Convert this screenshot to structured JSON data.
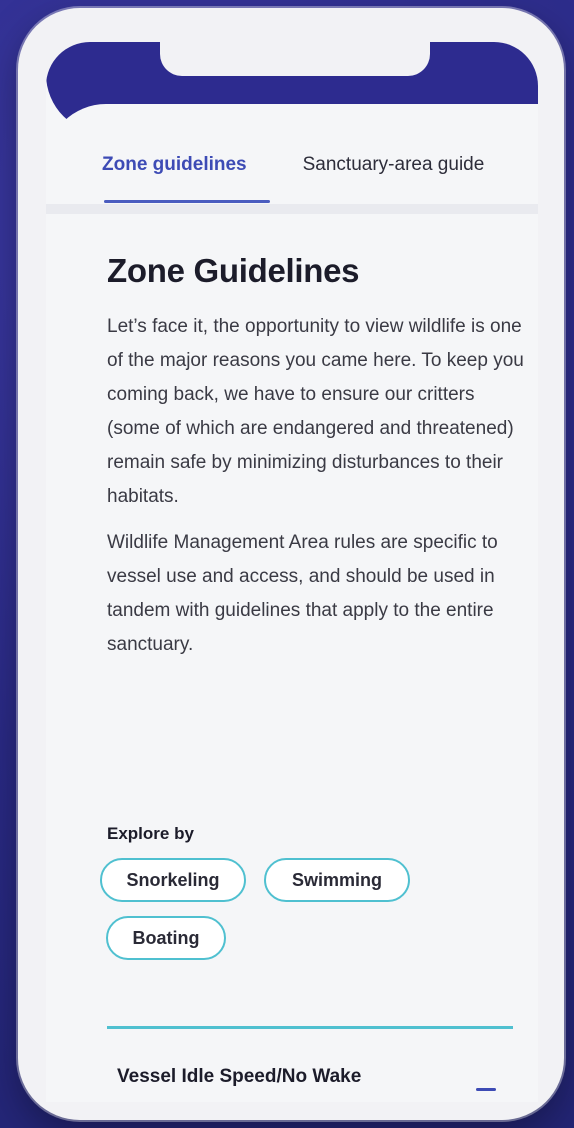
{
  "tabs": [
    {
      "label": "Zone guidelines",
      "active": true
    },
    {
      "label": "Sanctuary-area guide",
      "active": false
    }
  ],
  "page": {
    "title": "Zone Guidelines",
    "paragraphs": [
      "Let’s face it, the opportunity to view wildlife is one of the major reasons you came here. To keep you coming back, we have to ensure our critters (some of which are endangered and threatened) remain safe by minimizing disturbances to their habitats.",
      "Wildlife Management Area rules are specific to vessel use and access, and should be used in tandem with guidelines that apply to the entire sanctuary."
    ]
  },
  "explore": {
    "label": "Explore by",
    "chips": [
      "Snorkeling",
      "Swimming",
      "Boating"
    ]
  },
  "accordion": {
    "title": "Vessel Idle Speed/No Wake",
    "toggle_icon": "minus-icon"
  },
  "colors": {
    "brand_navy": "#2d2b8f",
    "accent_blue": "#3d4bb5",
    "chip_border": "#4fc0d0"
  }
}
